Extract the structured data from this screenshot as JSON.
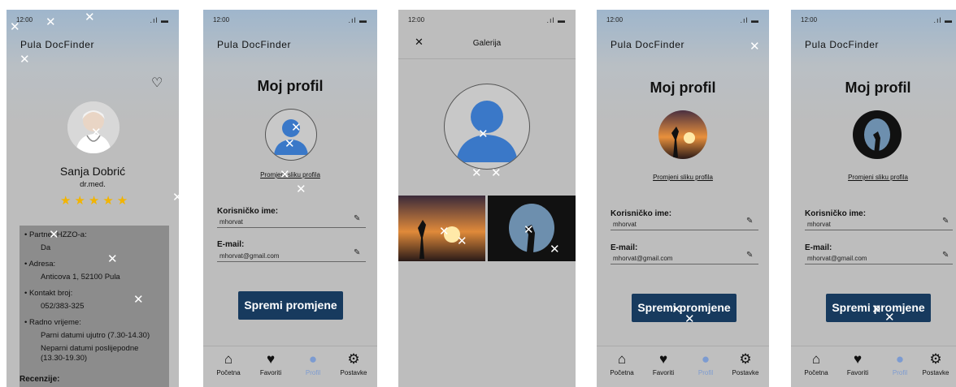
{
  "app": {
    "brand": "Pula DocFinder",
    "status_time": "12:00",
    "status_icons": "signal-battery"
  },
  "doctor_screen": {
    "name": "Sanja Dobrić",
    "title": "dr.med.",
    "rating": 5,
    "stars": "★★★★★",
    "details": [
      {
        "label": "Partner HZZO-a:",
        "value": "Da"
      },
      {
        "label": "Adresa:",
        "value": "Anticova 1, 52100 Pula"
      },
      {
        "label": "Kontakt broj:",
        "value": "052/383-325"
      },
      {
        "label": "Radno vrijeme:",
        "value": "Parni datumi ujutro (7.30-14.30)",
        "value2": "Neparni datumi poslijepodne",
        "value3": "(13.30-19.30)"
      }
    ],
    "reviews_label": "Recenzije:",
    "favorite_icon": "heart-outline-icon"
  },
  "profile_screen": {
    "title": "Moj profil",
    "change_photo": "Promjeni sliku profila",
    "username_label": "Korisničko ime:",
    "username_value": "mhorvat",
    "email_label": "E-mail:",
    "email_value": "mhorvat@gmail.com",
    "save_button": "Spremi promjene",
    "edit_icon": "pencil-icon"
  },
  "gallery_screen": {
    "title": "Galerija",
    "close_icon": "close-icon"
  },
  "nav": [
    {
      "label": "Početna",
      "icon": "home-icon"
    },
    {
      "label": "Favoriti",
      "icon": "heart-icon"
    },
    {
      "label": "Profil",
      "icon": "user-icon"
    },
    {
      "label": "Postavke",
      "icon": "gear-icon"
    }
  ],
  "colors": {
    "primary_button": "#173a5e",
    "active_nav": "#7c9bd1",
    "star": "#f2b400",
    "background": "#bdbdbd"
  }
}
